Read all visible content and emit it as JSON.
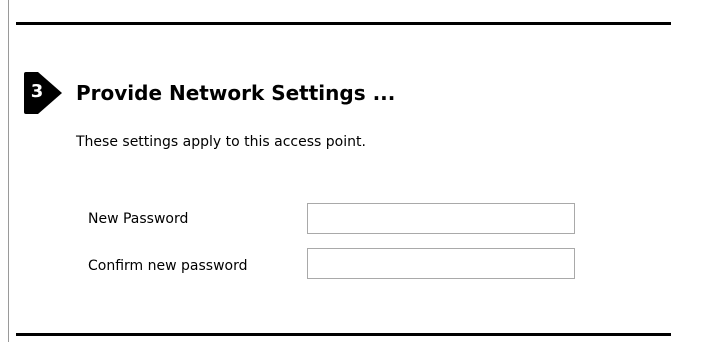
{
  "step": {
    "number": "3",
    "title": "Provide Network Settings ..."
  },
  "description": "These settings apply to this access point.",
  "form": {
    "new_password": {
      "label": "New Password",
      "value": "",
      "type": "password"
    },
    "confirm_password": {
      "label": "Confirm new password",
      "value": "",
      "type": "password"
    }
  },
  "colors": {
    "badge": "#000000",
    "rule": "#000000",
    "input_border": "#a9a9a9"
  }
}
